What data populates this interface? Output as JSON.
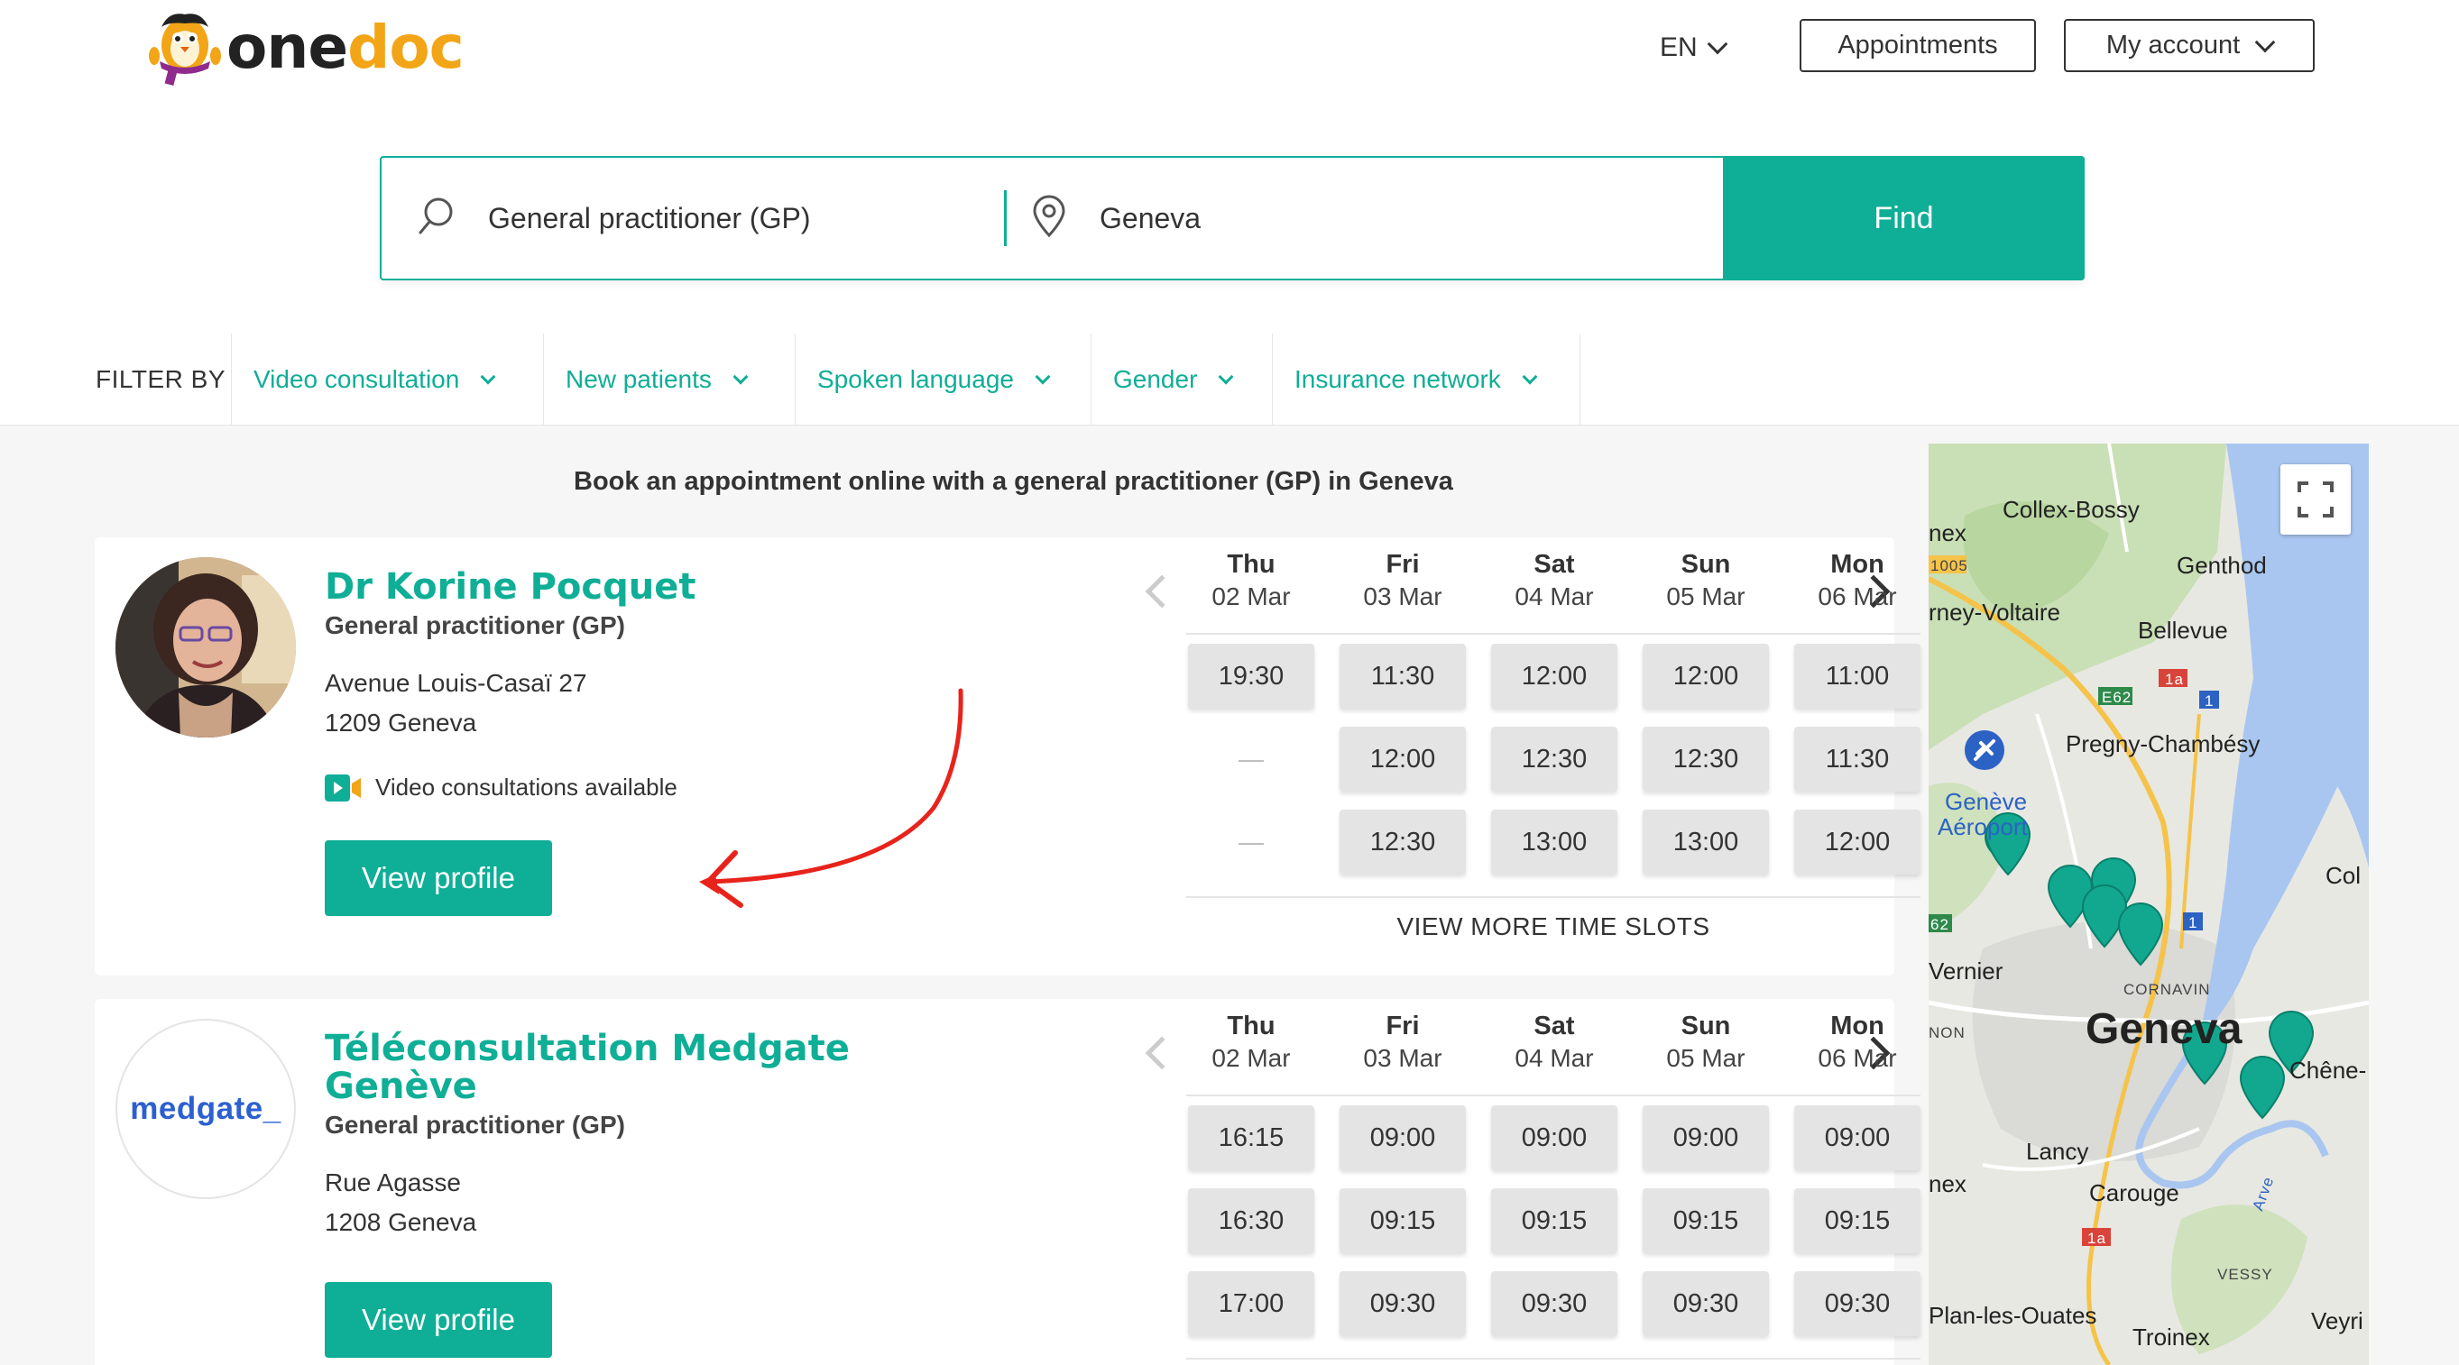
{
  "header": {
    "logo_one": "one",
    "logo_doc": "doc",
    "language": "EN",
    "appointments_label": "Appointments",
    "account_label": "My account"
  },
  "search": {
    "specialty_value": "General practitioner (GP)",
    "location_value": "Geneva",
    "find_label": "Find"
  },
  "filters": {
    "label": "FILTER BY",
    "items": [
      "Video consultation",
      "New patients",
      "Spoken language",
      "Gender",
      "Insurance network"
    ]
  },
  "results": {
    "heading": "Book an appointment online with a general practitioner (GP) in Geneva",
    "view_more": "VIEW MORE TIME SLOTS",
    "doctors": [
      {
        "name": "Dr Korine Pocquet",
        "specialty": "General practitioner (GP)",
        "address_line1": "Avenue Louis-Casaï 27",
        "address_line2": "1209 Geneva",
        "video_note": "Video consultations available",
        "profile_label": "View profile",
        "days": [
          {
            "name": "Thu",
            "date": "02 Mar",
            "slots": [
              "19:30",
              "—",
              "—"
            ]
          },
          {
            "name": "Fri",
            "date": "03 Mar",
            "slots": [
              "11:30",
              "12:00",
              "12:30"
            ]
          },
          {
            "name": "Sat",
            "date": "04 Mar",
            "slots": [
              "12:00",
              "12:30",
              "13:00"
            ]
          },
          {
            "name": "Sun",
            "date": "05 Mar",
            "slots": [
              "12:00",
              "12:30",
              "13:00"
            ]
          },
          {
            "name": "Mon",
            "date": "06 Mar",
            "slots": [
              "11:00",
              "11:30",
              "12:00"
            ]
          }
        ]
      },
      {
        "name": "Téléconsultation Medgate Genève",
        "logo_text": "medgate_",
        "specialty": "General practitioner (GP)",
        "address_line1": "Rue Agasse",
        "address_line2": "1208 Geneva",
        "profile_label": "View profile",
        "days": [
          {
            "name": "Thu",
            "date": "02 Mar",
            "slots": [
              "16:15",
              "16:30",
              "17:00"
            ]
          },
          {
            "name": "Fri",
            "date": "03 Mar",
            "slots": [
              "09:00",
              "09:15",
              "09:30"
            ]
          },
          {
            "name": "Sat",
            "date": "04 Mar",
            "slots": [
              "09:00",
              "09:15",
              "09:30"
            ]
          },
          {
            "name": "Sun",
            "date": "05 Mar",
            "slots": [
              "09:00",
              "09:15",
              "09:30"
            ]
          },
          {
            "name": "Mon",
            "date": "06 Mar",
            "slots": [
              "09:00",
              "09:15",
              "09:30"
            ]
          }
        ]
      }
    ]
  },
  "map": {
    "labels": [
      "Collex-Bossy",
      "Genthod",
      "Bellevue",
      "rney-Voltaire",
      "Pregny-Chambésy",
      "Genève",
      "Aéroport",
      "Vernier",
      "Geneva",
      "CORNAVIN",
      "Chêne-",
      "Lancy",
      "Carouge",
      "Plan-les-Ouates",
      "Troinex",
      "Veyri",
      "VESSY",
      "NON",
      "nex",
      "nex",
      "Col",
      "E62",
      "1a",
      "1",
      "1005",
      "62",
      "1",
      "1a",
      "Arve"
    ]
  },
  "colors": {
    "brand_teal": "#0fae96",
    "logo_orange": "#f2a516",
    "annotation_red": "#e8231b"
  }
}
